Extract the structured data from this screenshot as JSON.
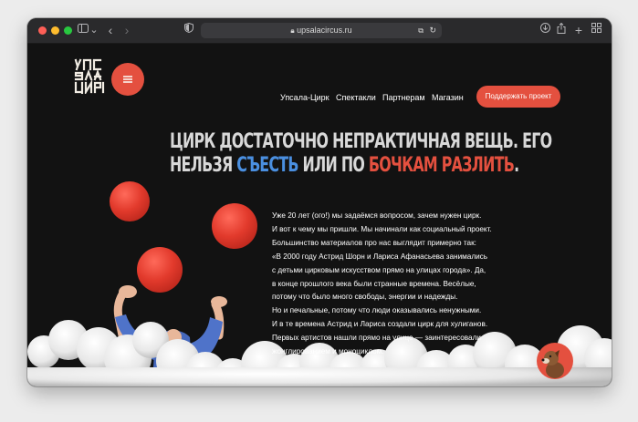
{
  "browser": {
    "url": "upsalacircus.ru"
  },
  "colors": {
    "accent": "#e4503f",
    "highlight_blue": "#4a8fe0",
    "background": "#121212"
  },
  "header": {
    "logo_text": "УПСАЛА ЦИРК",
    "nav": [
      "Упсала-Цирк",
      "Спектакли",
      "Партнерам",
      "Магазин"
    ],
    "cta_label": "Поддержать проект"
  },
  "hero": {
    "headline_line1": "ЦИРК ДОСТАТОЧНО НЕПРАКТИЧНАЯ ВЕЩЬ. ЕГО",
    "headline_line2_a": "НЕЛЬЗЯ ",
    "headline_line2_blue": "СЪЕСТЬ",
    "headline_line2_b": " ИЛИ ПО ",
    "headline_line2_red": "БОЧКАМ РАЗЛИТЬ",
    "headline_line2_c": "."
  },
  "body_lines": [
    "Уже 20 лет (ого!) мы задаёмся вопросом, зачем нужен цирк.",
    "И вот к чему мы пришли. Мы начинали как социальный проект.",
    "Большинство материалов про нас выглядит примерно так:",
    "«В 2000 году Астрид Шорн и Лариса Афанасьева занимались",
    "с детьми цирковым искусством прямо на улицах города». Да,",
    "в конце прошлого века были странные времена. Весёлые,",
    "потому что было много свободы, энергии и надежды.",
    "Но и печальные, потому что люди оказывались ненужными.",
    "И в те времена Астрид и Лариса создали цирк для хулиганов.",
    "Первых артистов нашли прямо на улице — заинтересовали",
    "жонглированием и моноциклом."
  ]
}
